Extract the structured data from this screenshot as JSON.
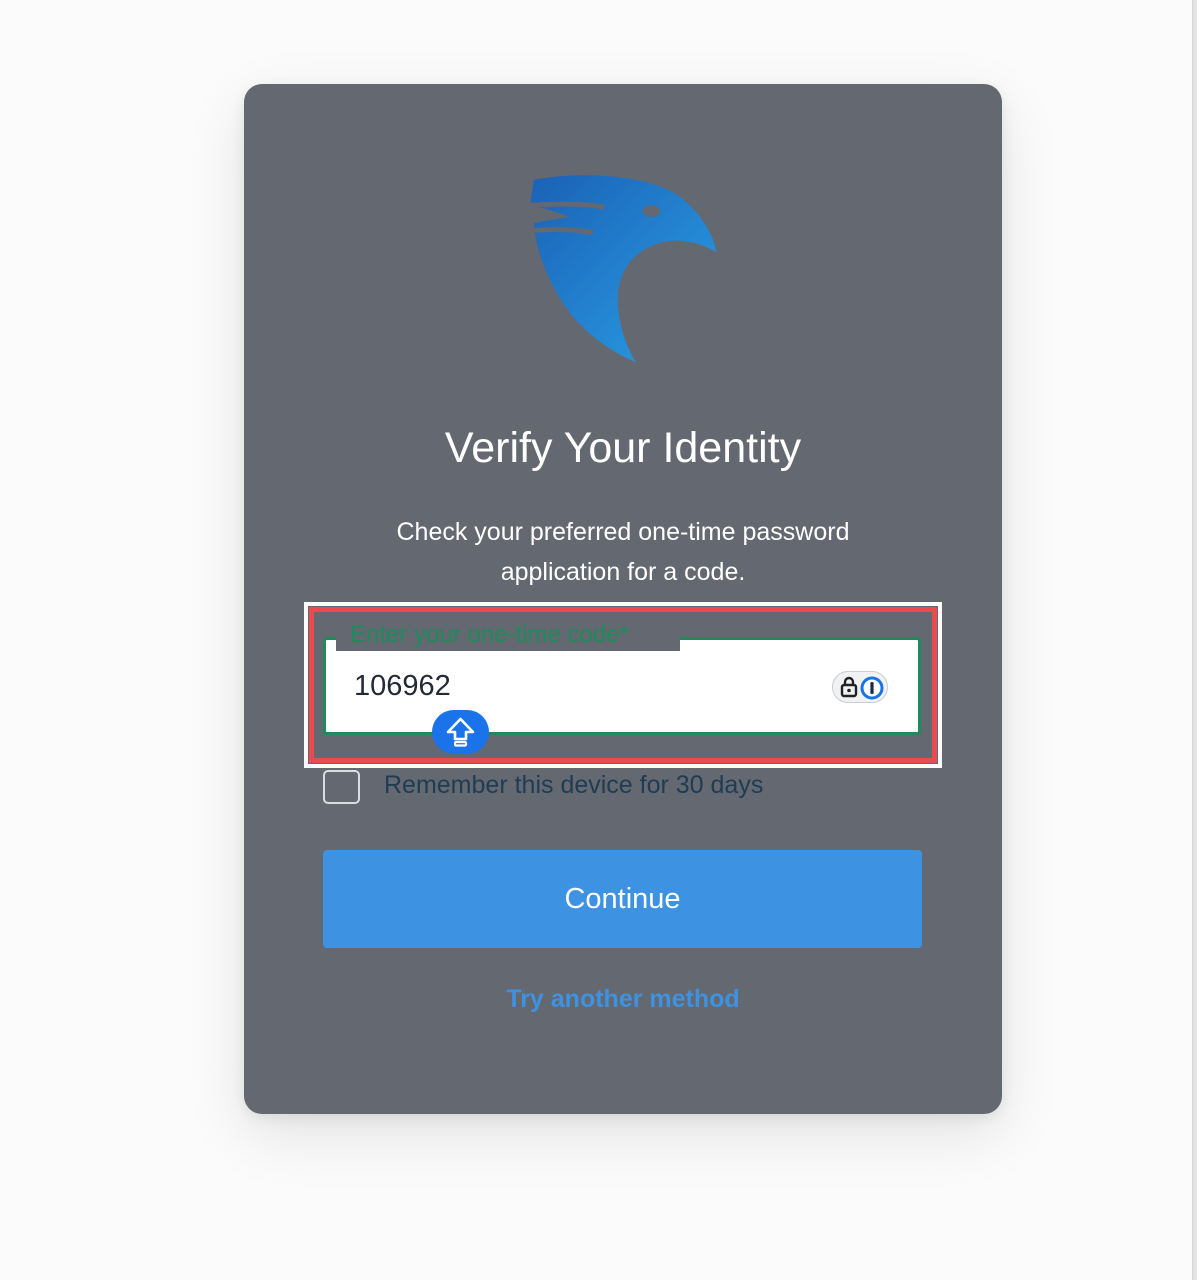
{
  "dialog": {
    "title": "Verify Your Identity",
    "subtitle": "Check your preferred one-time password application for a code.",
    "code_field": {
      "label": "Enter your one-time code*",
      "value": "106962"
    },
    "remember_label": "Remember this device for 30 days",
    "remember_checked": false,
    "continue_label": "Continue",
    "alt_method_label": "Try another method"
  },
  "icons": {
    "logo": "eagle-head-logo-icon",
    "password_manager": "password-manager-lock-icon",
    "shift_key": "shift-arrow-icon"
  },
  "colors": {
    "card_bg": "#646870",
    "accent_blue": "#3d92e2",
    "field_border_green": "#1e8b5c",
    "highlight_red": "#e94b4f"
  }
}
